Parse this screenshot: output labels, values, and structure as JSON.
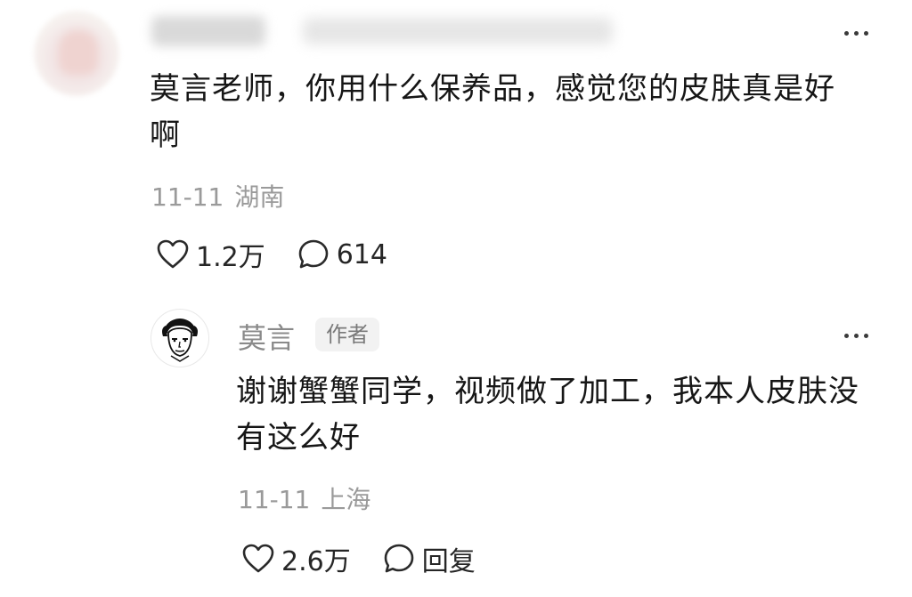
{
  "comment": {
    "text": "莫言老师，你用什么保养品，感觉您的皮肤真是好啊",
    "date": "11-11",
    "location": "湖南",
    "likes": "1.2万",
    "replies": "614"
  },
  "reply": {
    "author_name": "莫言",
    "author_badge": "作者",
    "text": "谢谢蟹蟹同学，视频做了加工，我本人皮肤没有这么好",
    "date": "11-11",
    "location": "上海",
    "likes": "2.6万",
    "reply_label": "回复"
  },
  "icons": {
    "more": "more-horizontal-icon",
    "like": "heart-outline-icon",
    "comment": "comment-bubble-icon"
  },
  "colors": {
    "text_primary": "#161616",
    "text_secondary": "#9a9a9a",
    "badge_bg": "#f2f2f2"
  }
}
